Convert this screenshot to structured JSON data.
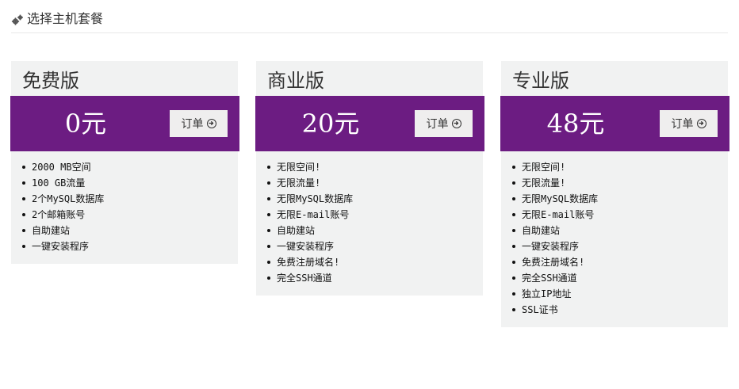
{
  "header": {
    "title": "选择主机套餐",
    "icon": "gears-icon"
  },
  "colors": {
    "accent": "#6c1c82",
    "card_bg": "#f1f2f2",
    "button_bg": "#efeeee"
  },
  "plans": [
    {
      "name": "免费版",
      "price": "0元",
      "order_label": "订单",
      "features": [
        "2000 MB空间",
        "100 GB流量",
        "2个MySQL数据库",
        "2个邮箱账号",
        "自助建站",
        "一键安装程序"
      ]
    },
    {
      "name": "商业版",
      "price": "20元",
      "order_label": "订单",
      "features": [
        "无限空间!",
        "无限流量!",
        "无限MySQL数据库",
        "无限E-mail账号",
        "自助建站",
        "一键安装程序",
        "免费注册域名!",
        "完全SSH通道"
      ]
    },
    {
      "name": "专业版",
      "price": "48元",
      "order_label": "订单",
      "features": [
        "无限空间!",
        "无限流量!",
        "无限MySQL数据库",
        "无限E-mail账号",
        "自助建站",
        "一键安装程序",
        "免费注册域名!",
        "完全SSH通道",
        "独立IP地址",
        "SSL证书"
      ]
    }
  ]
}
